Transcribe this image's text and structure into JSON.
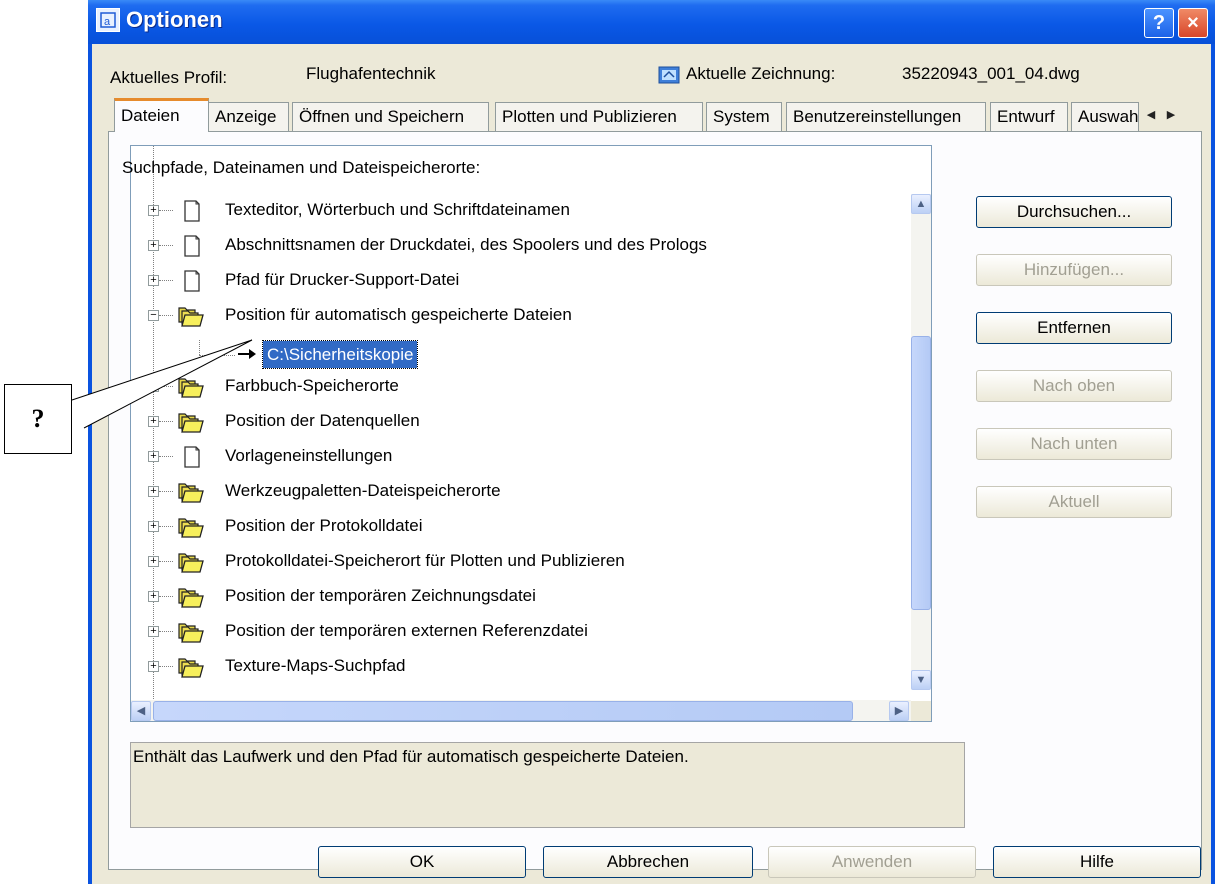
{
  "window": {
    "title": "Optionen",
    "help_label": "?",
    "close_label": "×"
  },
  "header": {
    "profile_label": "Aktuelles Profil:",
    "profile_value": "Flughafentechnik",
    "drawing_label": "Aktuelle Zeichnung:",
    "drawing_value": "35220943_001_04.dwg"
  },
  "tabs": [
    {
      "label": "Dateien",
      "active": true
    },
    {
      "label": "Anzeige"
    },
    {
      "label": "Öffnen und Speichern"
    },
    {
      "label": "Plotten und Publizieren"
    },
    {
      "label": "System"
    },
    {
      "label": "Benutzereinstellungen"
    },
    {
      "label": "Entwurf"
    },
    {
      "label": "Auswah"
    }
  ],
  "section_label": "Suchpfade, Dateinamen und Dateispeicherorte:",
  "tree": {
    "items": [
      {
        "label": "Texteditor, Wörterbuch und Schriftdateinamen",
        "icon": "document-icon"
      },
      {
        "label": "Abschnittsnamen der Druckdatei, des Spoolers und des Prologs",
        "icon": "document-icon"
      },
      {
        "label": "Pfad für Drucker-Support-Datei",
        "icon": "document-icon"
      },
      {
        "label": "Position für automatisch gespeicherte Dateien",
        "icon": "folder-stack-icon",
        "expanded": true
      },
      {
        "label": "Farbbuch-Speicherorte",
        "icon": "folder-stack-icon"
      },
      {
        "label": "Position der Datenquellen",
        "icon": "folder-stack-icon"
      },
      {
        "label": "Vorlageneinstellungen",
        "icon": "document-icon"
      },
      {
        "label": "Werkzeugpaletten-Dateispeicherorte",
        "icon": "folder-stack-icon"
      },
      {
        "label": "Position der Protokolldatei",
        "icon": "folder-stack-icon"
      },
      {
        "label": "Protokolldatei-Speicherort für Plotten und Publizieren",
        "icon": "folder-stack-icon"
      },
      {
        "label": "Position der temporären Zeichnungsdatei",
        "icon": "folder-stack-icon"
      },
      {
        "label": "Position der temporären externen Referenzdatei",
        "icon": "folder-stack-icon"
      },
      {
        "label": "Texture-Maps-Suchpfad",
        "icon": "folder-stack-icon"
      }
    ],
    "selected_child": "C:\\Sicherheitskopie"
  },
  "side_buttons": {
    "browse": "Durchsuchen...",
    "add": "Hinzufügen...",
    "remove": "Entfernen",
    "move_up": "Nach oben",
    "move_down": "Nach unten",
    "current": "Aktuell"
  },
  "description": "Enthält das Laufwerk und den Pfad für automatisch gespeicherte Dateien.",
  "footer": {
    "ok": "OK",
    "cancel": "Abbrechen",
    "apply": "Anwenden",
    "help": "Hilfe"
  },
  "callout": {
    "text": "?"
  },
  "colors": {
    "titlebar": "#0a58e6",
    "selection": "#316ac5",
    "folder": "#f5e94a",
    "dialog_bg": "#ece9d8"
  }
}
